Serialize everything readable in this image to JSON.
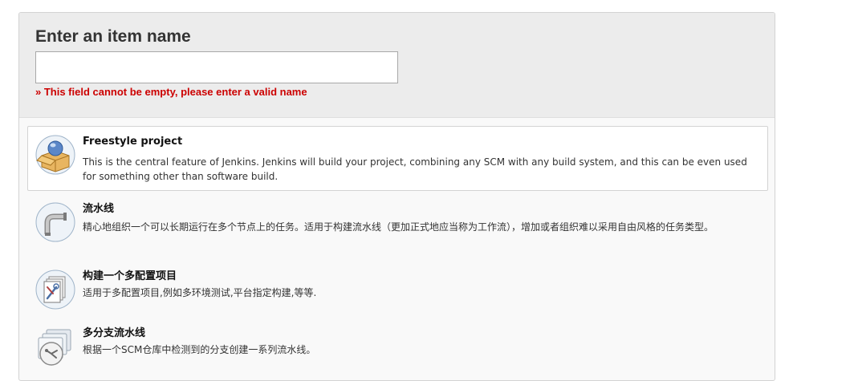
{
  "header": {
    "title": "Enter an item name",
    "input_value": "",
    "error": "» This field cannot be empty, please enter a valid name"
  },
  "items": [
    {
      "title": "Freestyle project",
      "description": "This is the central feature of Jenkins. Jenkins will build your project, combining any SCM with any build system, and this can be even used for something other than software build.",
      "icon": "freestyle-project-icon"
    },
    {
      "title": "流水线",
      "description": "精心地组织一个可以长期运行在多个节点上的任务。适用于构建流水线（更加正式地应当称为工作流），增加或者组织难以采用自由风格的任务类型。",
      "icon": "pipeline-icon"
    },
    {
      "title": "构建一个多配置项目",
      "description": "适用于多配置项目,例如多环境测试,平台指定构建,等等.",
      "icon": "multi-config-icon"
    },
    {
      "title": "多分支流水线",
      "description": "根据一个SCM仓库中检测到的分支创建一系列流水线。",
      "icon": "multibranch-pipeline-icon"
    }
  ],
  "colors": {
    "error": "#cc0000",
    "header_bg": "#ececec",
    "panel_bg": "#f9f9f9"
  }
}
